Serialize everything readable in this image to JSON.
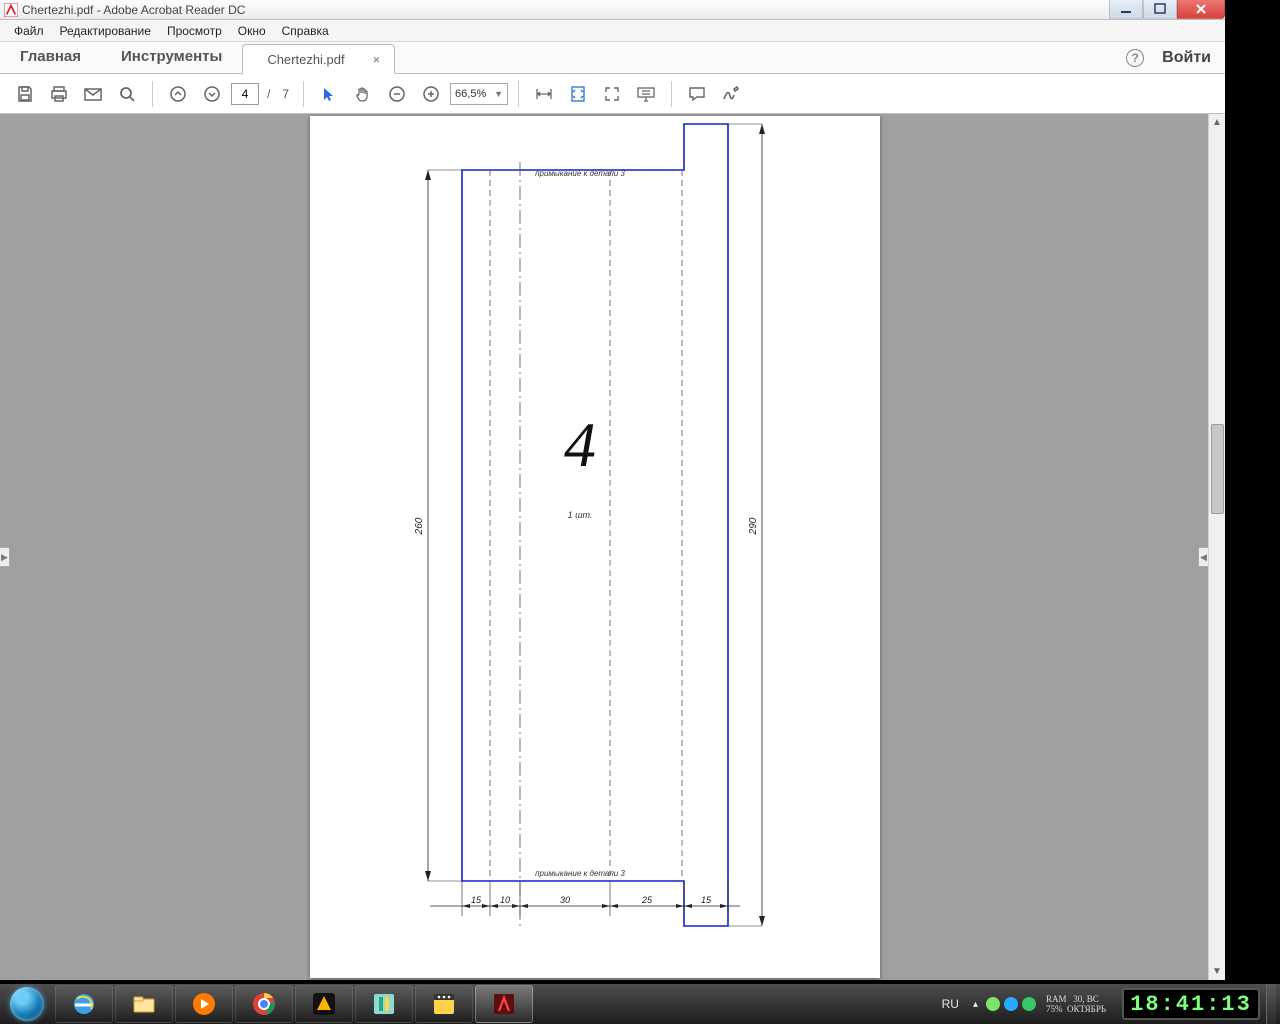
{
  "window": {
    "title": "Chertezhi.pdf - Adobe Acrobat Reader DC"
  },
  "menu": {
    "items": [
      "Файл",
      "Редактирование",
      "Просмотр",
      "Окно",
      "Справка"
    ]
  },
  "tabs": {
    "home": "Главная",
    "tools": "Инструменты",
    "file": "Chertezhi.pdf",
    "close": "×",
    "help": "?",
    "login": "Войти"
  },
  "toolbar": {
    "page": "4",
    "sep": "/",
    "total": "7",
    "zoom": "66,5%"
  },
  "drawing": {
    "part": "4",
    "qty": "1 шт.",
    "top_note": "примыкание к детали 3",
    "bottom_note": "примыкание к детали 3",
    "dim_left": "260",
    "dim_right": "290",
    "dims_bottom": [
      "15",
      "10",
      "30",
      "25",
      "15"
    ]
  },
  "taskbar": {
    "lang": "RU"
  },
  "sysinfo": {
    "l1a": "RAM",
    "l1b": "30, ВС",
    "l2a": "75%",
    "l2b": "ОКТЯБРЬ"
  },
  "clock": {
    "time": "18:41:13"
  }
}
